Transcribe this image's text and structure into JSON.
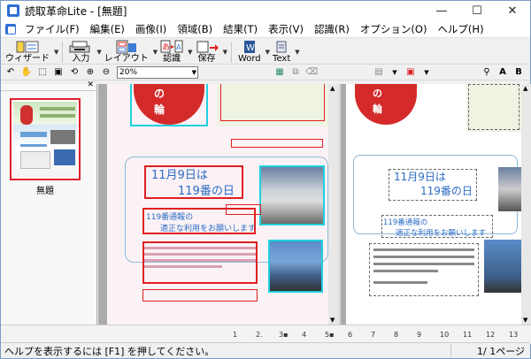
{
  "window": {
    "title": "読取革命Lite - [無題]",
    "minimize": "—",
    "maximize": "☐",
    "close": "✕"
  },
  "menu": [
    "ファイル(F)",
    "編集(E)",
    "画像(I)",
    "領域(B)",
    "結果(T)",
    "表示(V)",
    "認識(R)",
    "オプション(O)",
    "ヘルプ(H)"
  ],
  "toolbar": {
    "wizard": "ウィザード",
    "input": "入力",
    "layout": "レイアウト",
    "recognize": "認識",
    "save": "保存",
    "word": "Word",
    "text": "Text"
  },
  "zoom": "20%",
  "thumbnail": {
    "label": "無題"
  },
  "page_texts": {
    "left_heading1": "11月9日は",
    "left_heading2": "119番の日",
    "left_sub1": "119番通報の",
    "left_sub2": "適正な利用をお願いします",
    "left_circle": "の",
    "left_circle2": "輪",
    "right_heading1": "11月9日は",
    "right_heading2": "119番の日",
    "right_sub1": "119番通報の",
    "right_sub2": "適正な利用をお願いします",
    "right_circle": "の",
    "right_circle2": "輪"
  },
  "tabs": [
    "1",
    "2.",
    "3▪",
    "4",
    "5▪",
    "6",
    "7",
    "8",
    "9",
    "10",
    "11",
    "12",
    "13"
  ],
  "status": {
    "help": "ヘルプを表示するには [F1] を押してください。",
    "page": "1/ 1ページ"
  },
  "colors": {
    "box_red": "#e02020",
    "box_cyan": "#20d0e0",
    "heading_blue": "#2b6cc4"
  }
}
